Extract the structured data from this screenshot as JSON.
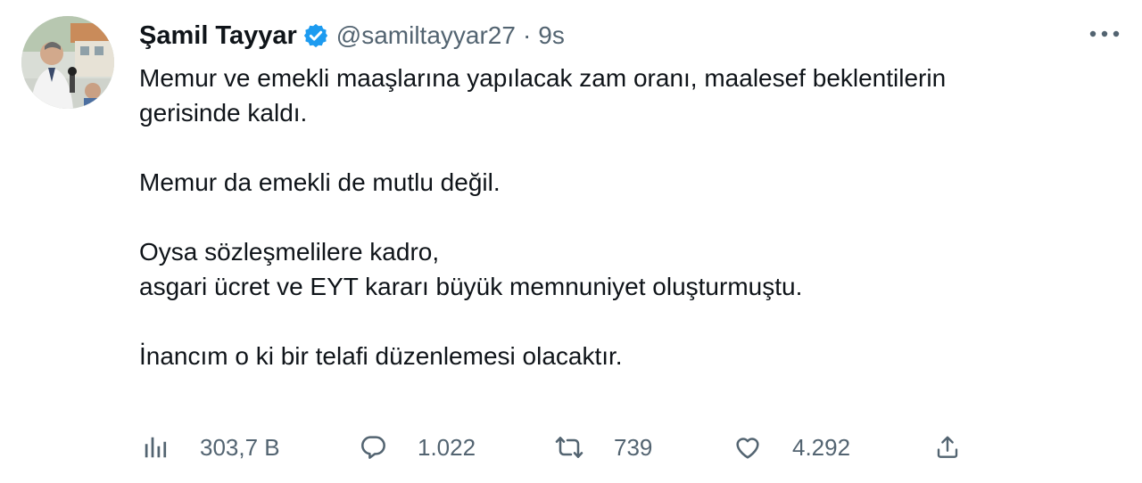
{
  "author": {
    "display_name": "Şamil Tayyar",
    "handle": "@samiltayyar27",
    "separator": "·",
    "time": "9s",
    "verified": true
  },
  "tweet": {
    "paragraphs": [
      "Memur ve emekli maaşlarına yapılacak zam oranı, maalesef beklentilerin\ngerisinde kaldı.",
      "Memur da emekli de mutlu değil.",
      "Oysa sözleşmelilere kadro,\nasgari ücret ve EYT kararı büyük memnuniyet oluşturmuştu.",
      "İnancım o ki bir telafi düzenlemesi olacaktır."
    ]
  },
  "stats": {
    "views": "303,7 B",
    "replies": "1.022",
    "retweets": "739",
    "likes": "4.292"
  },
  "icons": {
    "verified": "verified-badge-icon",
    "more": "more-dots-icon",
    "views": "bar-chart-icon",
    "reply": "speech-bubble-icon",
    "retweet": "retweet-arrows-icon",
    "like": "heart-icon",
    "share": "share-upload-icon"
  },
  "colors": {
    "text": "#0f1419",
    "secondary": "#536471",
    "verified": "#1d9bf0",
    "background": "#ffffff"
  }
}
